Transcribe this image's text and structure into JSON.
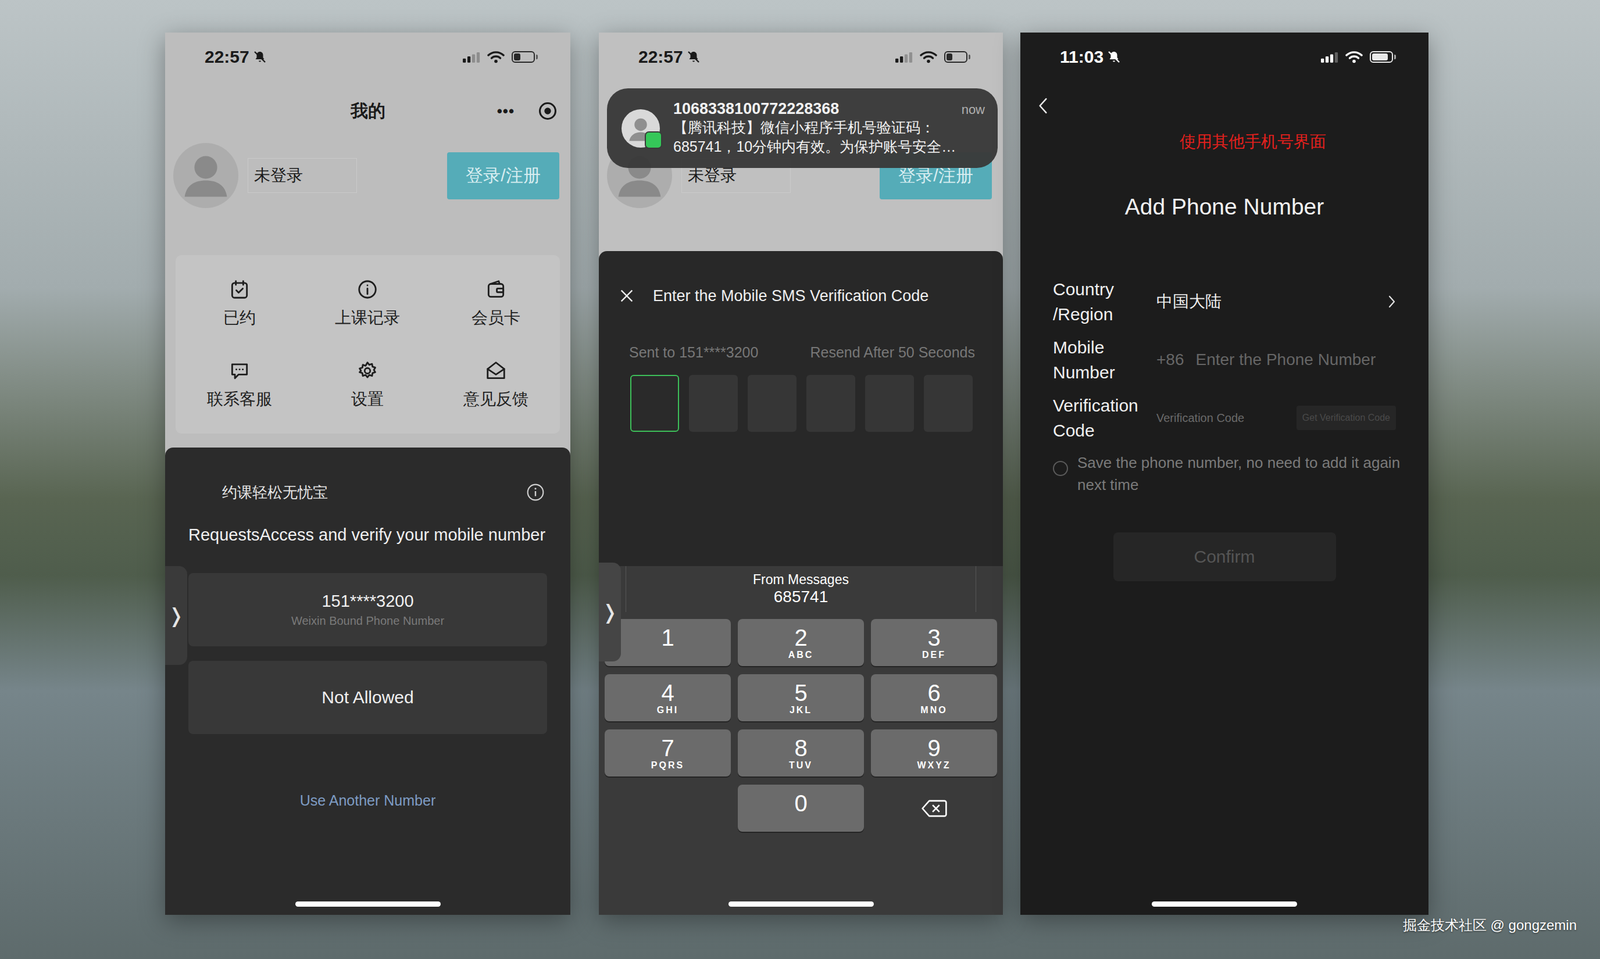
{
  "watermark": "掘金技术社区 @ gongzemin",
  "screen1": {
    "status_bar": {
      "time": "22:57",
      "silent": true,
      "signal": 2,
      "battery_level": 0.35
    },
    "nav": {
      "title": "我的",
      "more": "•••"
    },
    "profile": {
      "name": "未登录",
      "button": "登录/注册"
    },
    "menu": [
      {
        "label": "已约"
      },
      {
        "label": "上课记录"
      },
      {
        "label": "会员卡"
      },
      {
        "label": "联系客服"
      },
      {
        "label": "设置"
      },
      {
        "label": "意见反馈"
      }
    ],
    "sheet": {
      "app_name": "约课轻松无忧宝",
      "message": "RequestsAccess and verify your mobile number",
      "phone": {
        "number": "151****3200",
        "caption": "Weixin Bound Phone Number"
      },
      "deny_button": "Not Allowed",
      "link": "Use Another Number"
    },
    "side_tab": "❭"
  },
  "screen2": {
    "status_bar": {
      "time": "22:57",
      "silent": true,
      "signal": 2,
      "battery_level": 0.3
    },
    "page": {
      "name": "未登录",
      "button": "登录/注册"
    },
    "notification": {
      "sender": "1068338100772228368",
      "time": "now",
      "lines": [
        "【腾讯科技】微信小程序手机号验证码：",
        "685741，10分钟内有效。为保护账号安全…"
      ]
    },
    "sheet": {
      "title": "Enter the Mobile SMS Verification Code",
      "sent_to": "Sent to 151****3200",
      "resend": "Resend After 50 Seconds",
      "code": [
        {
          "value": "",
          "selected": true
        },
        {
          "value": "",
          "selected": false
        },
        {
          "value": "",
          "selected": false
        },
        {
          "value": "",
          "selected": false
        },
        {
          "value": "",
          "selected": false
        },
        {
          "value": "",
          "selected": false
        }
      ]
    },
    "keyboard": {
      "suggestion_source": "From Messages",
      "suggestion": "685741",
      "keys": [
        {
          "kind": "digit",
          "digit": "1",
          "letters": ""
        },
        {
          "kind": "digit",
          "digit": "2",
          "letters": "ABC"
        },
        {
          "kind": "digit",
          "digit": "3",
          "letters": "DEF"
        },
        {
          "kind": "digit",
          "digit": "4",
          "letters": "GHI"
        },
        {
          "kind": "digit",
          "digit": "5",
          "letters": "JKL"
        },
        {
          "kind": "digit",
          "digit": "6",
          "letters": "MNO"
        },
        {
          "kind": "digit",
          "digit": "7",
          "letters": "PQRS"
        },
        {
          "kind": "digit",
          "digit": "8",
          "letters": "TUV"
        },
        {
          "kind": "digit",
          "digit": "9",
          "letters": "WXYZ"
        },
        {
          "kind": "blank",
          "digit": "",
          "letters": ""
        },
        {
          "kind": "digit",
          "digit": "0",
          "letters": ""
        },
        {
          "kind": "backspace",
          "digit": "",
          "letters": ""
        }
      ]
    },
    "side_tab": "❭"
  },
  "screen3": {
    "status_bar": {
      "time": "11:03",
      "silent": true,
      "signal": 3,
      "battery_level": 0.85
    },
    "annotation": "使用其他手机号界面",
    "title": "Add Phone Number",
    "fields": [
      {
        "kind": "select",
        "label_lines": [
          "Country",
          "/Region"
        ],
        "value": "中国大陆",
        "prefix": "",
        "placeholder": "",
        "button": "",
        "button_disabled": false
      },
      {
        "kind": "phone",
        "label_lines": [
          "Mobile",
          "Number"
        ],
        "value": "",
        "prefix": "+86",
        "placeholder": "Enter the Phone Number",
        "button": "",
        "button_disabled": false
      },
      {
        "kind": "code",
        "label_lines": [
          "Verification",
          "Code"
        ],
        "value": "",
        "prefix": "",
        "placeholder": "Verification Code",
        "button": "Get Verification Code",
        "button_disabled": true
      }
    ],
    "save_option": {
      "label": "Save the phone number, no need to add it again next time",
      "checked": false
    },
    "confirm": {
      "label": "Confirm",
      "disabled": true
    }
  }
}
